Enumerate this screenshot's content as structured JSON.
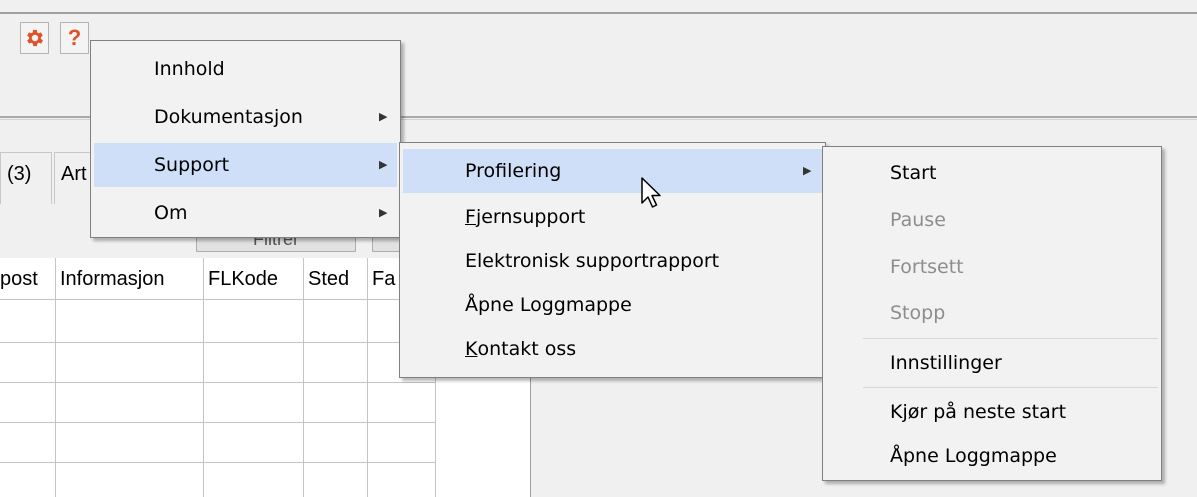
{
  "toolbar": {
    "settings_icon": "gear-icon",
    "help_icon": "question-mark-icon",
    "help_glyph": "?"
  },
  "tabs": [
    {
      "label": "(3)"
    },
    {
      "label": "Art"
    }
  ],
  "filter_button": {
    "label": "Filtrér"
  },
  "grid": {
    "columns": [
      "post",
      "Informasjon",
      "FLKode",
      "Sted",
      "Fa"
    ]
  },
  "help_menu": {
    "items": [
      {
        "label": "Innhold"
      },
      {
        "label": "Dokumentasjon"
      },
      {
        "label": "Support"
      },
      {
        "label": "Om"
      }
    ]
  },
  "support_menu": {
    "items": [
      {
        "label": "Profilering"
      },
      {
        "ul": "F",
        "rest": "jernsupport"
      },
      {
        "label": "Elektronisk supportrapport"
      },
      {
        "label": "Åpne Loggmappe"
      },
      {
        "ul": "K",
        "rest": "ontakt oss"
      }
    ]
  },
  "profiling_menu": {
    "items": [
      {
        "label": "Start"
      },
      {
        "label": "Pause"
      },
      {
        "label": "Fortsett"
      },
      {
        "label": "Stopp"
      },
      {
        "label": "Innstillinger"
      },
      {
        "label": "Kjør på neste start"
      },
      {
        "label": "Åpne Loggmappe"
      }
    ]
  },
  "colors": {
    "highlight": "#cfdff7",
    "gear": "#e0522a",
    "help": "#e0522a",
    "disabled_text": "#8d8d8d"
  }
}
